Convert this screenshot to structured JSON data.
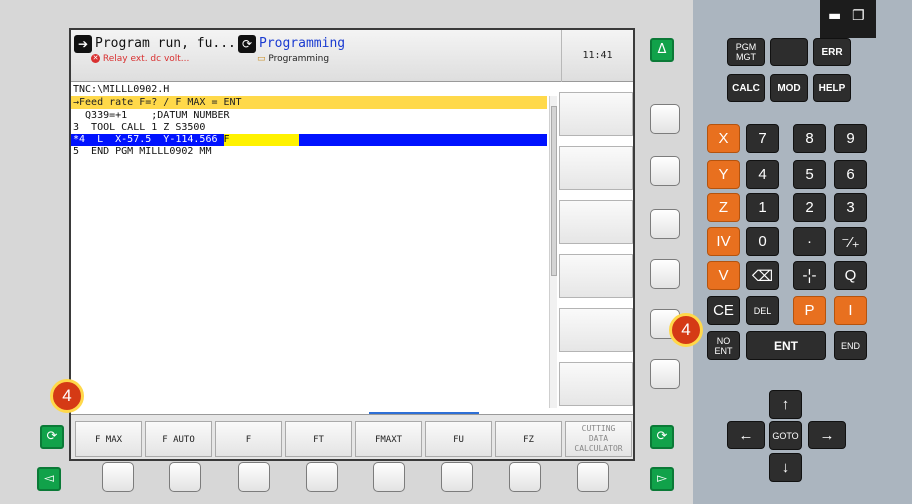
{
  "header": {
    "mode1_title": "Program run, fu...",
    "mode1_error": "Relay ext. dc volt...",
    "mode2_title": "Programming",
    "mode2_sub": "Programming",
    "clock": "11:41"
  },
  "editor": {
    "path": "TNC:\\MILLL0902.H",
    "prompt": "→Feed rate F=? / F MAX = ENT",
    "lines": [
      "  Q339=+1    ;DATUM NUMBER",
      "3  TOOL CALL 1 Z S3500",
      "*4  L  X-57.5  Y-114.566 ",
      "5  END PGM MILLL0902 MM"
    ],
    "input_value": "F"
  },
  "softkeys": {
    "fmax": "F MAX",
    "fauto": "F AUTO",
    "f": "F",
    "ft": "FT",
    "fmaxt": "FMAXT",
    "fu": "FU",
    "fz": "FZ",
    "cutting1": "CUTTING",
    "cutting2": "DATA",
    "cutting3": "CALCULATOR"
  },
  "badges": {
    "left": "4",
    "right": "4"
  },
  "side_buttons": {
    "delta": "Δ",
    "cycle": "⟳",
    "left_arrow": "◅",
    "right_arrow": "▻"
  },
  "keypad": {
    "pgm_mgt": "PGM\nMGT",
    "err": "ERR",
    "calc": "CALC",
    "mod": "MOD",
    "help": "HELP",
    "x": "X",
    "y": "Y",
    "z": "Z",
    "iv": "IV",
    "v": "V",
    "n7": "7",
    "n8": "8",
    "n9": "9",
    "n4": "4",
    "n5": "5",
    "n6": "6",
    "n1": "1",
    "n2": "2",
    "n3": "3",
    "n0": "0",
    "dot": "·",
    "sign": "⁻⁄₊",
    "backspace": "⌫",
    "actpos": "-¦-",
    "q": "Q",
    "ce": "CE",
    "del": "DEL",
    "p": "P",
    "i": "I",
    "noent": "NO\nENT",
    "ent": "ENT",
    "end": "END",
    "up": "↑",
    "left": "←",
    "goto": "GOTO",
    "right": "→",
    "down": "↓"
  },
  "window_controls": {
    "minimize": "▬",
    "restore": "❐"
  },
  "colors": {
    "orange": "#e8701f",
    "dark_key": "#2d2d2d",
    "green": "#11a24a",
    "highlight_blue": "#0012ff",
    "prompt_yellow": "#ffd94a"
  }
}
